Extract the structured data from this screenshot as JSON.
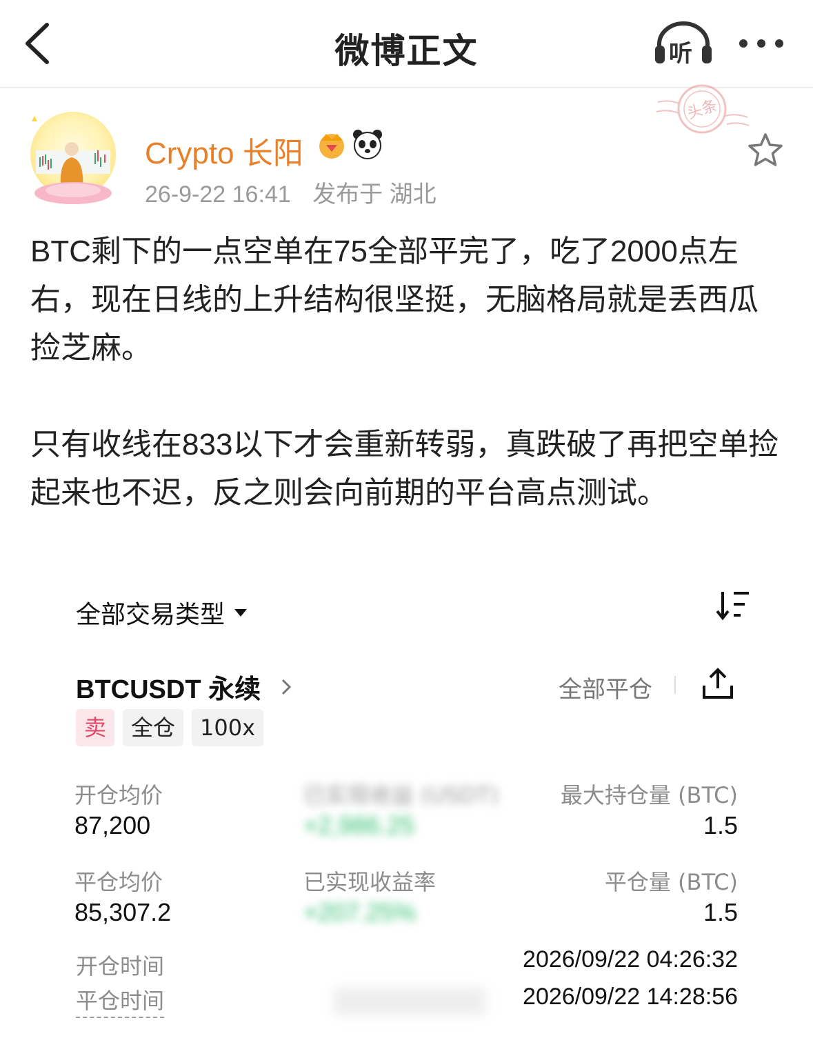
{
  "nav": {
    "title": "微博正文",
    "listen_label": "听"
  },
  "author": {
    "name": "Crypto 长阳",
    "badges": [
      "crown-badge-icon",
      "panda-badge-icon"
    ],
    "date": "26-9-22 16:41",
    "location": "发布于 湖北",
    "stamp_text": "头条"
  },
  "post": {
    "paragraph1": "BTC剩下的一点空单在75全部平完了，吃了2000点左右，现在日线的上升结构很坚挺，无脑格局就是丢西瓜捡芝麻。",
    "paragraph2": "只有收线在833以下才会重新转弱，真跌破了再把空单捡起来也不迟，反之则会向前期的平台高点测试。"
  },
  "trade": {
    "filter_label": "全部交易类型",
    "pair": "BTCUSDT 永续",
    "close_all": "全部平仓",
    "tags": {
      "side": "卖",
      "margin": "全仓",
      "leverage": "100x"
    },
    "open_avg_label": "开仓均价",
    "open_avg_value": "87,200",
    "realized_pnl_label": "已实现收益 (USDT)",
    "realized_pnl_value": "+2,986.25",
    "max_pos_label": "最大持仓量 (BTC)",
    "max_pos_value": "1.5",
    "close_avg_label": "平仓均价",
    "close_avg_value": "85,307.2",
    "realized_rate_label": "已实现收益率",
    "realized_rate_value": "+207.25%",
    "close_qty_label": "平仓量 (BTC)",
    "close_qty_value": "1.5",
    "open_time_label": "开仓时间",
    "open_time_value": "2026/09/22 04:26:32",
    "close_time_label": "平仓时间",
    "close_time_value": "2026/09/22 14:28:56"
  },
  "colors": {
    "author_name": "#e8802a",
    "sell_tag_bg": "#fbe6ea",
    "sell_tag_text": "#e04a6a",
    "profit_green": "#2fbf71"
  }
}
